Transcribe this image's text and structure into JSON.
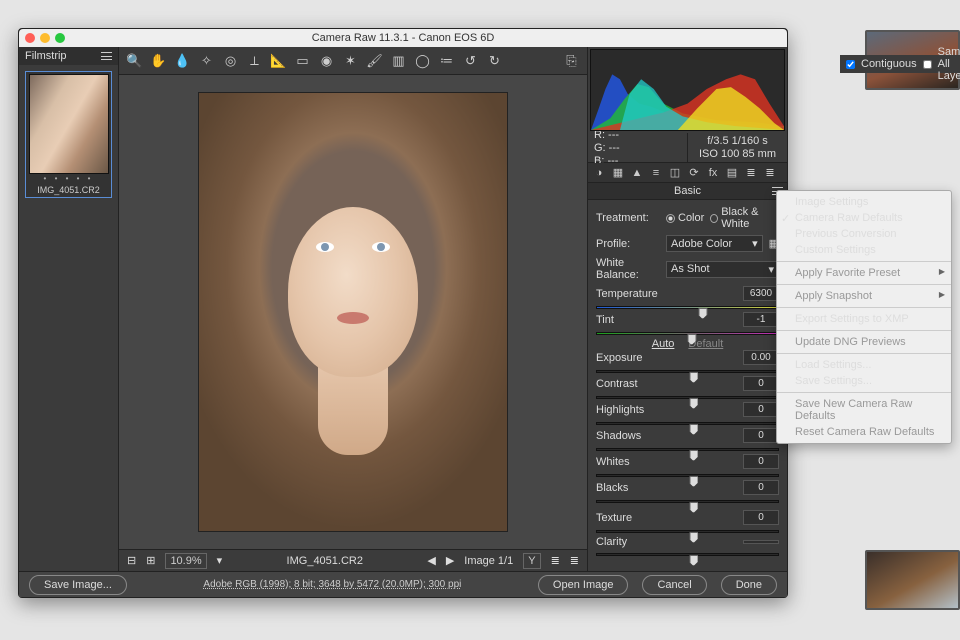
{
  "window": {
    "title": "Camera Raw 11.3.1  -  Canon EOS 6D"
  },
  "ps_options": {
    "contiguous": "Contiguous",
    "sample_all": "Sample All Laye"
  },
  "filmstrip": {
    "header": "Filmstrip",
    "thumb_name": "IMG_4051.CR2"
  },
  "meta": {
    "r": "R:   ---",
    "g": "G:   ---",
    "b": "B:   ---",
    "exposure": "f/3.5    1/160 s",
    "iso_lens": "ISO 100   85 mm"
  },
  "panel_title": "Basic",
  "treatment": {
    "label": "Treatment:",
    "color": "Color",
    "bw": "Black & White",
    "selected": "color"
  },
  "profile": {
    "label": "Profile:",
    "value": "Adobe Color"
  },
  "white_balance": {
    "label": "White Balance:",
    "value": "As Shot"
  },
  "temperature": {
    "label": "Temperature",
    "value": "6300",
    "pos": 55
  },
  "tint": {
    "label": "Tint",
    "value": "-1",
    "pos": 49
  },
  "auto": "Auto",
  "default": "Default",
  "exposure": {
    "label": "Exposure",
    "value": "0.00",
    "pos": 50
  },
  "contrast": {
    "label": "Contrast",
    "value": "0",
    "pos": 50
  },
  "highlights": {
    "label": "Highlights",
    "value": "0",
    "pos": 50
  },
  "shadows": {
    "label": "Shadows",
    "value": "0",
    "pos": 50
  },
  "whites": {
    "label": "Whites",
    "value": "0",
    "pos": 50
  },
  "blacks": {
    "label": "Blacks",
    "value": "0",
    "pos": 50
  },
  "texture": {
    "label": "Texture",
    "value": "0",
    "pos": 50
  },
  "clarity": {
    "label": "Clarity",
    "value": "",
    "pos": 50
  },
  "status": {
    "zoom": "10.9%",
    "file": "IMG_4051.CR2",
    "page": "Image 1/1"
  },
  "footer": {
    "save": "Save Image...",
    "info": "Adobe RGB (1998); 8 bit; 3648 by 5472 (20.0MP); 300 ppi",
    "open": "Open Image",
    "cancel": "Cancel",
    "done": "Done"
  },
  "menu": {
    "items": [
      {
        "label": "Image Settings",
        "type": "item"
      },
      {
        "label": "Camera Raw Defaults",
        "type": "check"
      },
      {
        "label": "Previous Conversion",
        "type": "item"
      },
      {
        "label": "Custom Settings",
        "type": "item"
      },
      {
        "type": "sep"
      },
      {
        "label": "Apply Favorite Preset",
        "type": "sub",
        "disabled": true
      },
      {
        "type": "sep"
      },
      {
        "label": "Apply Snapshot",
        "type": "sub",
        "disabled": true
      },
      {
        "type": "sep"
      },
      {
        "label": "Export Settings to XMP",
        "type": "item"
      },
      {
        "type": "sep"
      },
      {
        "label": "Update DNG Previews",
        "type": "item",
        "disabled": true
      },
      {
        "type": "sep"
      },
      {
        "label": "Load Settings...",
        "type": "item"
      },
      {
        "label": "Save Settings...",
        "type": "item"
      },
      {
        "type": "sep"
      },
      {
        "label": "Save New Camera Raw Defaults",
        "type": "item",
        "disabled": true
      },
      {
        "label": "Reset Camera Raw Defaults",
        "type": "item",
        "disabled": true
      }
    ]
  }
}
